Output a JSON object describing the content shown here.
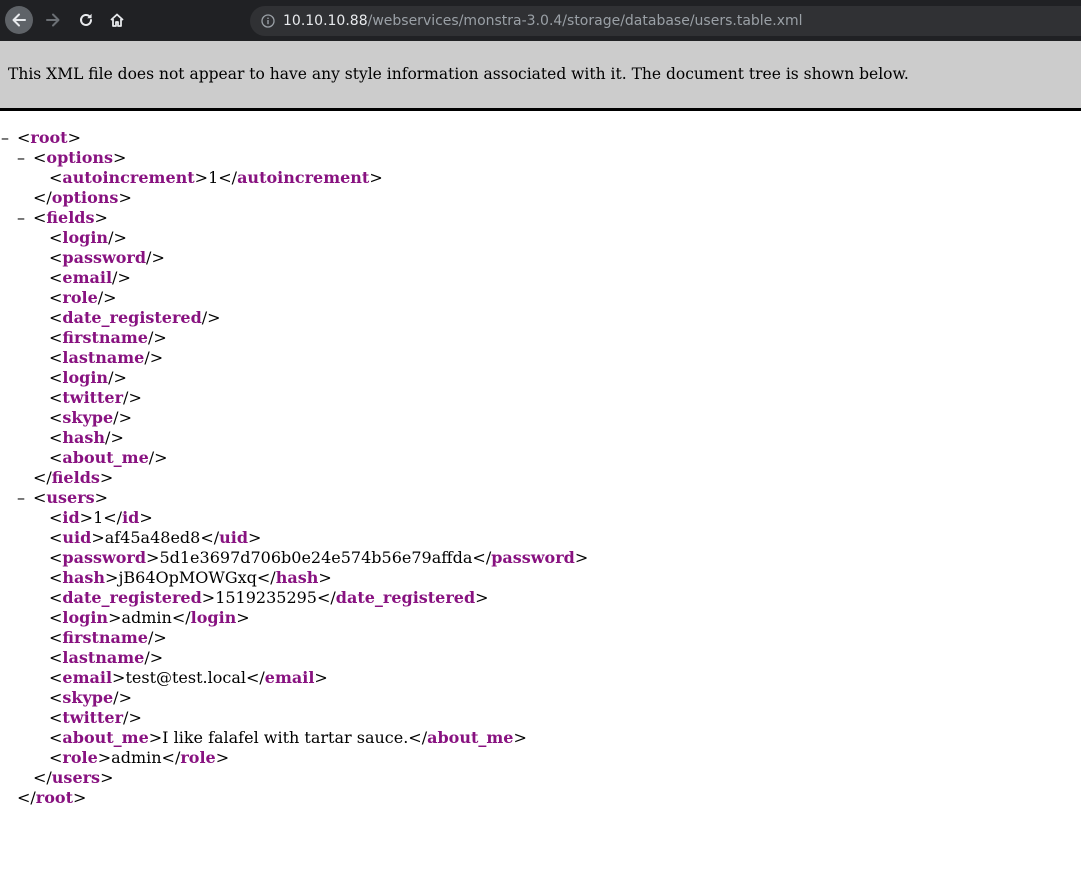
{
  "browser": {
    "url_host": "10.10.10.88",
    "url_path": "/webservices/monstra-3.0.4/storage/database/users.table.xml",
    "icons": {
      "back": "arrow-left-icon",
      "forward": "arrow-right-icon",
      "reload": "reload-icon",
      "home": "home-icon",
      "info": "info-circle-icon"
    },
    "colors": {
      "chrome_bg": "#202124",
      "omnibox_bg": "#303134",
      "tag": "#881280",
      "banner_bg": "#cccccc"
    }
  },
  "banner": {
    "text": "This XML file does not appear to have any style information associated with it. The document tree is shown below."
  },
  "xml": {
    "collapse_symbol": "–",
    "lines": [
      {
        "kind": "open",
        "tag": "root",
        "toggle": true
      },
      {
        "kind": "open",
        "tag": "options",
        "toggle": true
      },
      {
        "kind": "element",
        "tag": "autoincrement",
        "text": "1"
      },
      {
        "kind": "close",
        "tag": "options"
      },
      {
        "kind": "open",
        "tag": "fields",
        "toggle": true
      },
      {
        "kind": "selfclose",
        "tag": "login"
      },
      {
        "kind": "selfclose",
        "tag": "password"
      },
      {
        "kind": "selfclose",
        "tag": "email"
      },
      {
        "kind": "selfclose",
        "tag": "role"
      },
      {
        "kind": "selfclose",
        "tag": "date_registered"
      },
      {
        "kind": "selfclose",
        "tag": "firstname"
      },
      {
        "kind": "selfclose",
        "tag": "lastname"
      },
      {
        "kind": "selfclose",
        "tag": "login"
      },
      {
        "kind": "selfclose",
        "tag": "twitter"
      },
      {
        "kind": "selfclose",
        "tag": "skype"
      },
      {
        "kind": "selfclose",
        "tag": "hash"
      },
      {
        "kind": "selfclose",
        "tag": "about_me"
      },
      {
        "kind": "close",
        "tag": "fields"
      },
      {
        "kind": "open",
        "tag": "users",
        "toggle": true
      },
      {
        "kind": "element",
        "tag": "id",
        "text": "1"
      },
      {
        "kind": "element",
        "tag": "uid",
        "text": "af45a48ed8"
      },
      {
        "kind": "element",
        "tag": "password",
        "text": "5d1e3697d706b0e24e574b56e79affda"
      },
      {
        "kind": "element",
        "tag": "hash",
        "text": "jB64OpMOWGxq"
      },
      {
        "kind": "element",
        "tag": "date_registered",
        "text": "1519235295"
      },
      {
        "kind": "element",
        "tag": "login",
        "text": "admin"
      },
      {
        "kind": "selfclose",
        "tag": "firstname"
      },
      {
        "kind": "selfclose",
        "tag": "lastname"
      },
      {
        "kind": "element",
        "tag": "email",
        "text": "test@test.local"
      },
      {
        "kind": "selfclose",
        "tag": "skype"
      },
      {
        "kind": "selfclose",
        "tag": "twitter"
      },
      {
        "kind": "element",
        "tag": "about_me",
        "text": "I like falafel with tartar sauce."
      },
      {
        "kind": "element",
        "tag": "role",
        "text": "admin"
      },
      {
        "kind": "close",
        "tag": "users"
      },
      {
        "kind": "close",
        "tag": "root"
      }
    ]
  }
}
